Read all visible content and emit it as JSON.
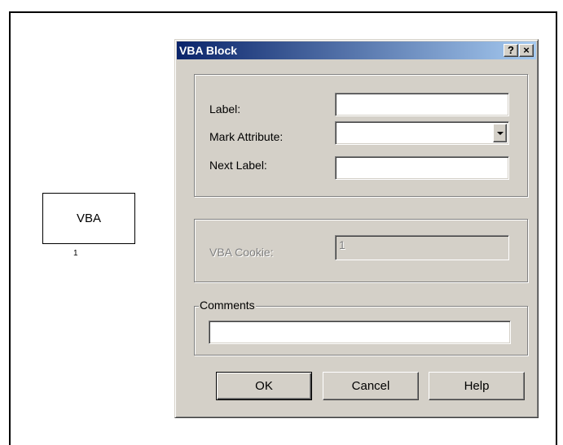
{
  "canvas": {
    "block": {
      "label": "VBA",
      "number": "1"
    }
  },
  "dialog": {
    "title": "VBA Block",
    "help_button": "?",
    "close_button": "×",
    "fields": {
      "label": {
        "label": "Label:",
        "value": ""
      },
      "mark_attribute": {
        "label": "Mark Attribute:",
        "value": ""
      },
      "next_label": {
        "label": "Next Label:",
        "value": ""
      },
      "vba_cookie": {
        "label": "VBA Cookie:",
        "value": "1"
      },
      "comments": {
        "label": "Comments",
        "value": ""
      }
    },
    "buttons": {
      "ok": "OK",
      "cancel": "Cancel",
      "help": "Help"
    }
  }
}
